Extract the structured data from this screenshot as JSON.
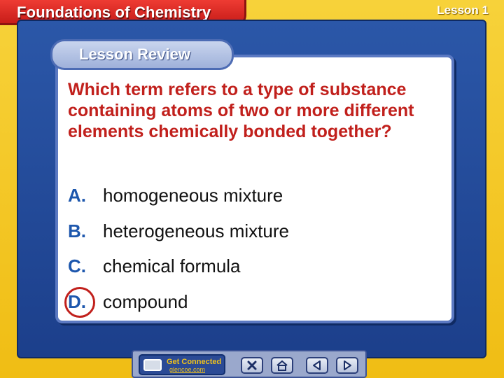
{
  "header": {
    "title": "Foundations of Chemistry",
    "lesson": "Lesson 1"
  },
  "card": {
    "tab_label": "Lesson Review",
    "question": "Which term refers to a type of substance containing atoms of two or more different elements chemically bonded together?",
    "answers": [
      {
        "letter": "A.",
        "text": "homogeneous mixture"
      },
      {
        "letter": "B.",
        "text": "heterogeneous mixture"
      },
      {
        "letter": "C.",
        "text": "chemical formula"
      },
      {
        "letter": "D.",
        "text": "compound"
      }
    ],
    "correct_answer": "D."
  },
  "nav": {
    "get_connected_title": "Get Connected",
    "get_connected_url": "glencoe.com",
    "buttons": [
      "close-icon",
      "home-icon",
      "prev-arrow-icon",
      "next-arrow-icon"
    ]
  },
  "colors": {
    "accent_red": "#c1201c",
    "letter_blue": "#1d57ad",
    "panel_blue": "#2b57a8",
    "frame_yellow": "#f3c51c"
  }
}
